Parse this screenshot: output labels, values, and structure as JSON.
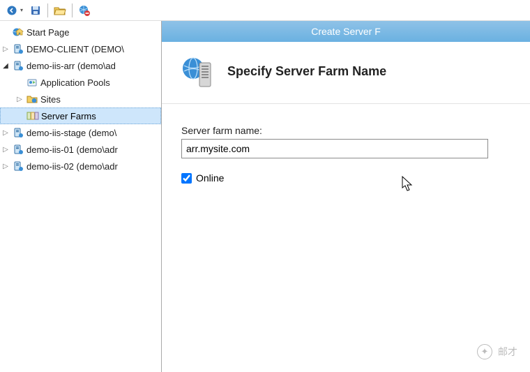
{
  "dialog": {
    "title": "Create Server F",
    "heading": "Specify Server Farm Name",
    "farm_name_label": "Server farm name:",
    "farm_name_value": "arr.mysite.com",
    "online_label": "Online",
    "online_checked": true
  },
  "tree": {
    "start_page": "Start Page",
    "demo_client": "DEMO-CLIENT (DEMO\\",
    "demo_iis_arr": "demo-iis-arr (demo\\ad",
    "app_pools": "Application Pools",
    "sites": "Sites",
    "server_farms": "Server Farms",
    "demo_iis_stage": "demo-iis-stage (demo\\",
    "demo_iis_01": "demo-iis-01 (demo\\adr",
    "demo_iis_02": "demo-iis-02 (demo\\adr"
  },
  "watermark": "邮才"
}
